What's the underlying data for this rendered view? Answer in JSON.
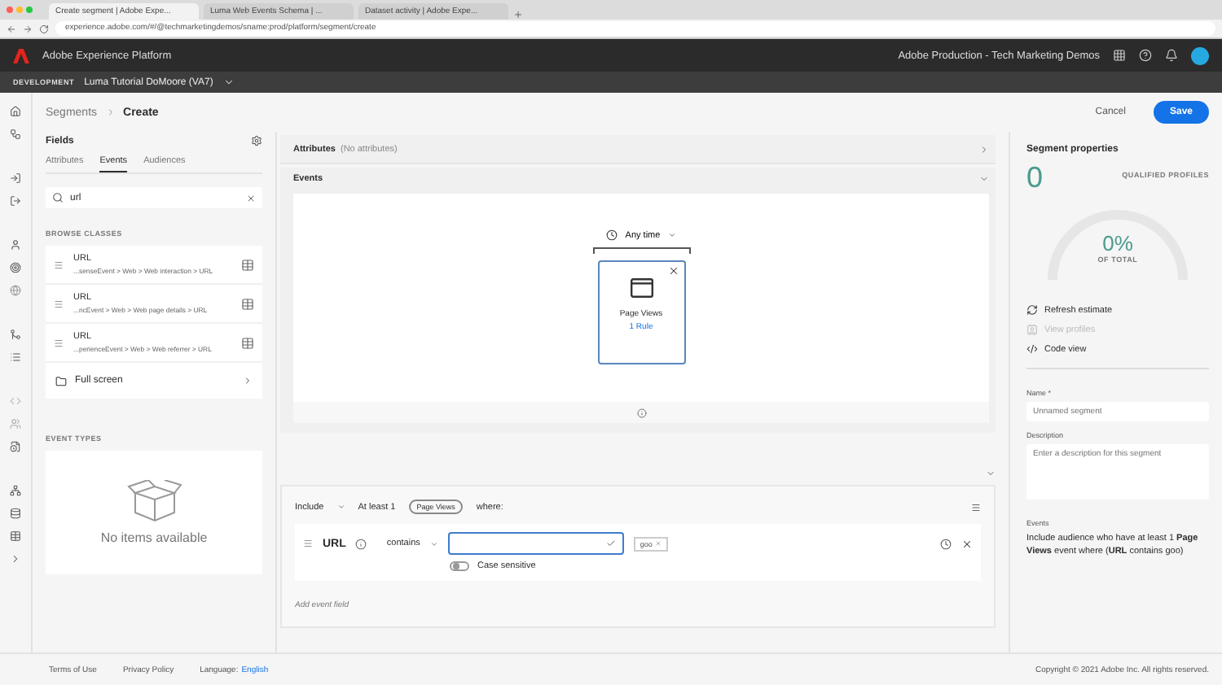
{
  "browser": {
    "tabs": [
      {
        "title": "Create segment | Adobe Expe...",
        "selected": true
      },
      {
        "title": "Luma Web Events Schema | ...",
        "selected": false
      },
      {
        "title": "Dataset activity | Adobe Expe...",
        "selected": false
      }
    ],
    "url": "experience.adobe.com/#/@techmarketingdemos/sname:prod/platform/segment/create"
  },
  "header": {
    "product": "Adobe Experience Platform",
    "org": "Adobe Production - Tech Marketing Demos"
  },
  "sandbox": {
    "label": "DEVELOPMENT",
    "name": "Luma Tutorial DoMoore (VA7)"
  },
  "breadcrumb": [
    "Segments",
    "Create"
  ],
  "actions": {
    "cancel": "Cancel",
    "save": "Save"
  },
  "fields": {
    "title": "Fields",
    "tabs": [
      {
        "label": "Attributes",
        "selected": false
      },
      {
        "label": "Events",
        "selected": true
      },
      {
        "label": "Audiences",
        "selected": false
      }
    ],
    "search": {
      "value": "url"
    },
    "browse_label": "BROWSE CLASSES",
    "classes": [
      {
        "name": "URL",
        "path": "...senseEvent > Web > Web interaction > URL"
      },
      {
        "name": "URL",
        "path": "...ncEvent > Web > Web page details > URL"
      },
      {
        "name": "URL",
        "path": "...perienceEvent > Web > Web referrer > URL"
      }
    ],
    "folder": "Full screen",
    "event_types_label": "EVENT TYPES",
    "empty": "No items available"
  },
  "attributes": {
    "title": "Attributes",
    "note": "(No attributes)"
  },
  "events": {
    "title": "Events",
    "time": "Any time",
    "card": {
      "title": "Page Views",
      "rules": "1 Rule"
    }
  },
  "rule": {
    "include": "Include",
    "at_least": "At least 1",
    "event_tag": "Page Views",
    "where": "where:",
    "field": "URL",
    "operator": "contains",
    "tag": "goo",
    "case_sensitive": {
      "label": "Case sensitive",
      "on": false
    },
    "add": "Add event field"
  },
  "properties": {
    "title": "Segment properties",
    "count": "0",
    "qualified": "QUALIFIED PROFILES",
    "percent": "0%",
    "of_total": "OF TOTAL",
    "actions": [
      {
        "label": "Refresh estimate",
        "kind": "refresh",
        "disabled": false
      },
      {
        "label": "View profiles",
        "kind": "profiles",
        "disabled": true
      },
      {
        "label": "Code view",
        "kind": "code",
        "disabled": false
      }
    ],
    "name_label": "Name *",
    "name_placeholder": "Unnamed segment",
    "desc_label": "Description",
    "desc_placeholder": "Enter a description for this segment",
    "events_label": "Events",
    "summary": "Include audience who have at least 1 **Page Views** event where (**URL** contains goo)"
  },
  "footer": {
    "links": [
      "Terms of Use",
      "Privacy Policy"
    ],
    "language_label": "Language:",
    "language": "English",
    "copyright": "Copyright © 2021 Adobe Inc. All rights reserved."
  }
}
